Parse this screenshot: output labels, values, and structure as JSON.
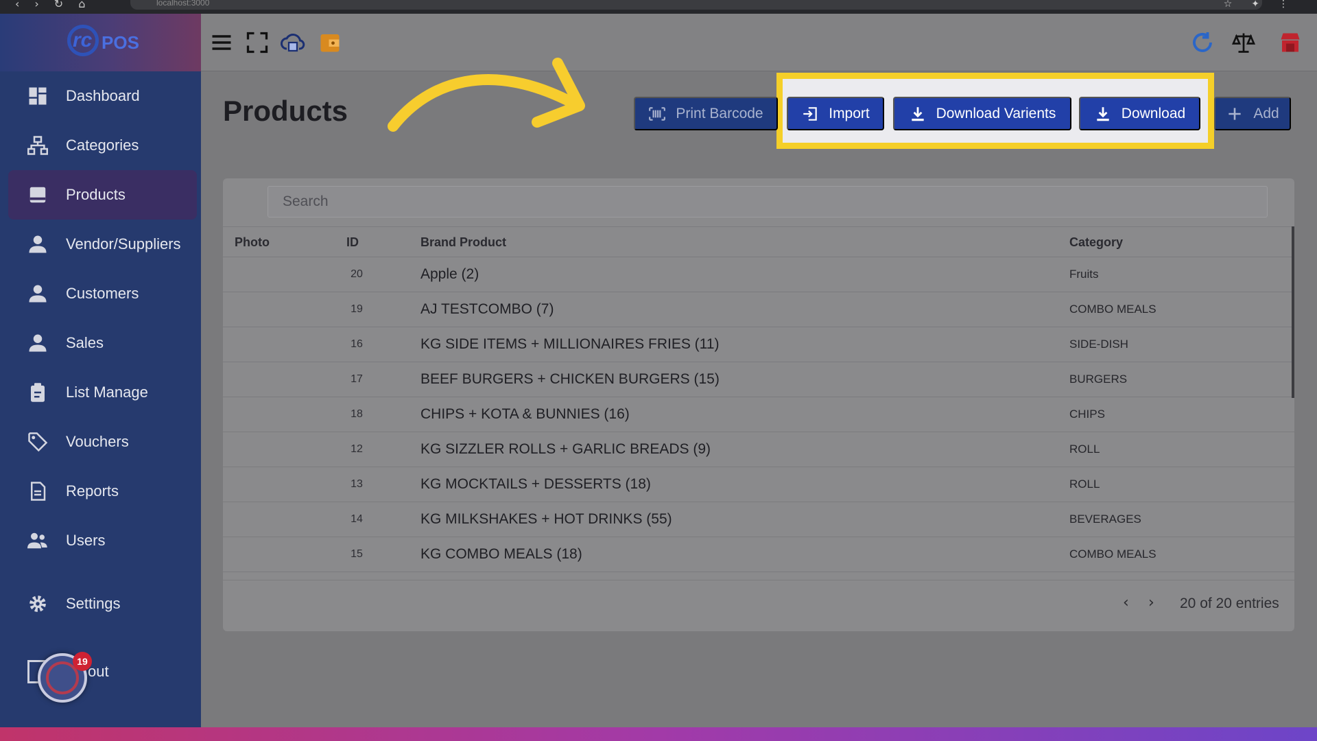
{
  "browser": {
    "url": "localhost:3000"
  },
  "sidebar": {
    "logo": {
      "rc": "rc",
      "pos": "POS"
    },
    "items": [
      {
        "label": "Dashboard",
        "icon": "dashboard-icon"
      },
      {
        "label": "Categories",
        "icon": "sitemap-icon"
      },
      {
        "label": "Products",
        "icon": "box-icon",
        "active": true
      },
      {
        "label": "Vendor/Suppliers",
        "icon": "person-icon"
      },
      {
        "label": "Customers",
        "icon": "person-icon"
      },
      {
        "label": "Sales",
        "icon": "person-icon"
      },
      {
        "label": "List Manage",
        "icon": "clipboard-icon"
      },
      {
        "label": "Vouchers",
        "icon": "tag-icon"
      },
      {
        "label": "Reports",
        "icon": "file-icon"
      },
      {
        "label": "Users",
        "icon": "users-icon"
      }
    ],
    "settings": "Settings",
    "logout_visible": "out",
    "fab_badge": "19"
  },
  "page": {
    "title": "Products"
  },
  "toolbar": {
    "print_barcode": "Print Barcode",
    "import": "Import",
    "download_varients": "Download Varients",
    "download": "Download",
    "add": "Add"
  },
  "table": {
    "search_placeholder": "Search",
    "headers": {
      "photo": "Photo",
      "id": "ID",
      "brand": "Brand Product",
      "category": "Category"
    },
    "rows": [
      {
        "id": "20",
        "brand": "Apple (2)",
        "category": "Fruits"
      },
      {
        "id": "19",
        "brand": "AJ TESTCOMBO (7)",
        "category": "COMBO MEALS"
      },
      {
        "id": "16",
        "brand": "KG SIDE ITEMS + MILLIONAIRES FRIES (11)",
        "category": "SIDE-DISH"
      },
      {
        "id": "17",
        "brand": "BEEF BURGERS + CHICKEN BURGERS (15)",
        "category": "BURGERS"
      },
      {
        "id": "18",
        "brand": "CHIPS + KOTA & BUNNIES (16)",
        "category": "CHIPS"
      },
      {
        "id": "12",
        "brand": "KG SIZZLER ROLLS + GARLIC BREADS (9)",
        "category": "ROLL"
      },
      {
        "id": "13",
        "brand": "KG MOCKTAILS + DESSERTS (18)",
        "category": "ROLL"
      },
      {
        "id": "14",
        "brand": "KG MILKSHAKES + HOT DRINKS (55)",
        "category": "BEVERAGES"
      },
      {
        "id": "15",
        "brand": "KG COMBO MEALS (18)",
        "category": "COMBO MEALS"
      }
    ],
    "pagination": {
      "info": "20 of 20 entries"
    }
  },
  "colors": {
    "accent": "#2240a8",
    "highlight": "#f5cf29",
    "sidebar": "#263a6e"
  }
}
